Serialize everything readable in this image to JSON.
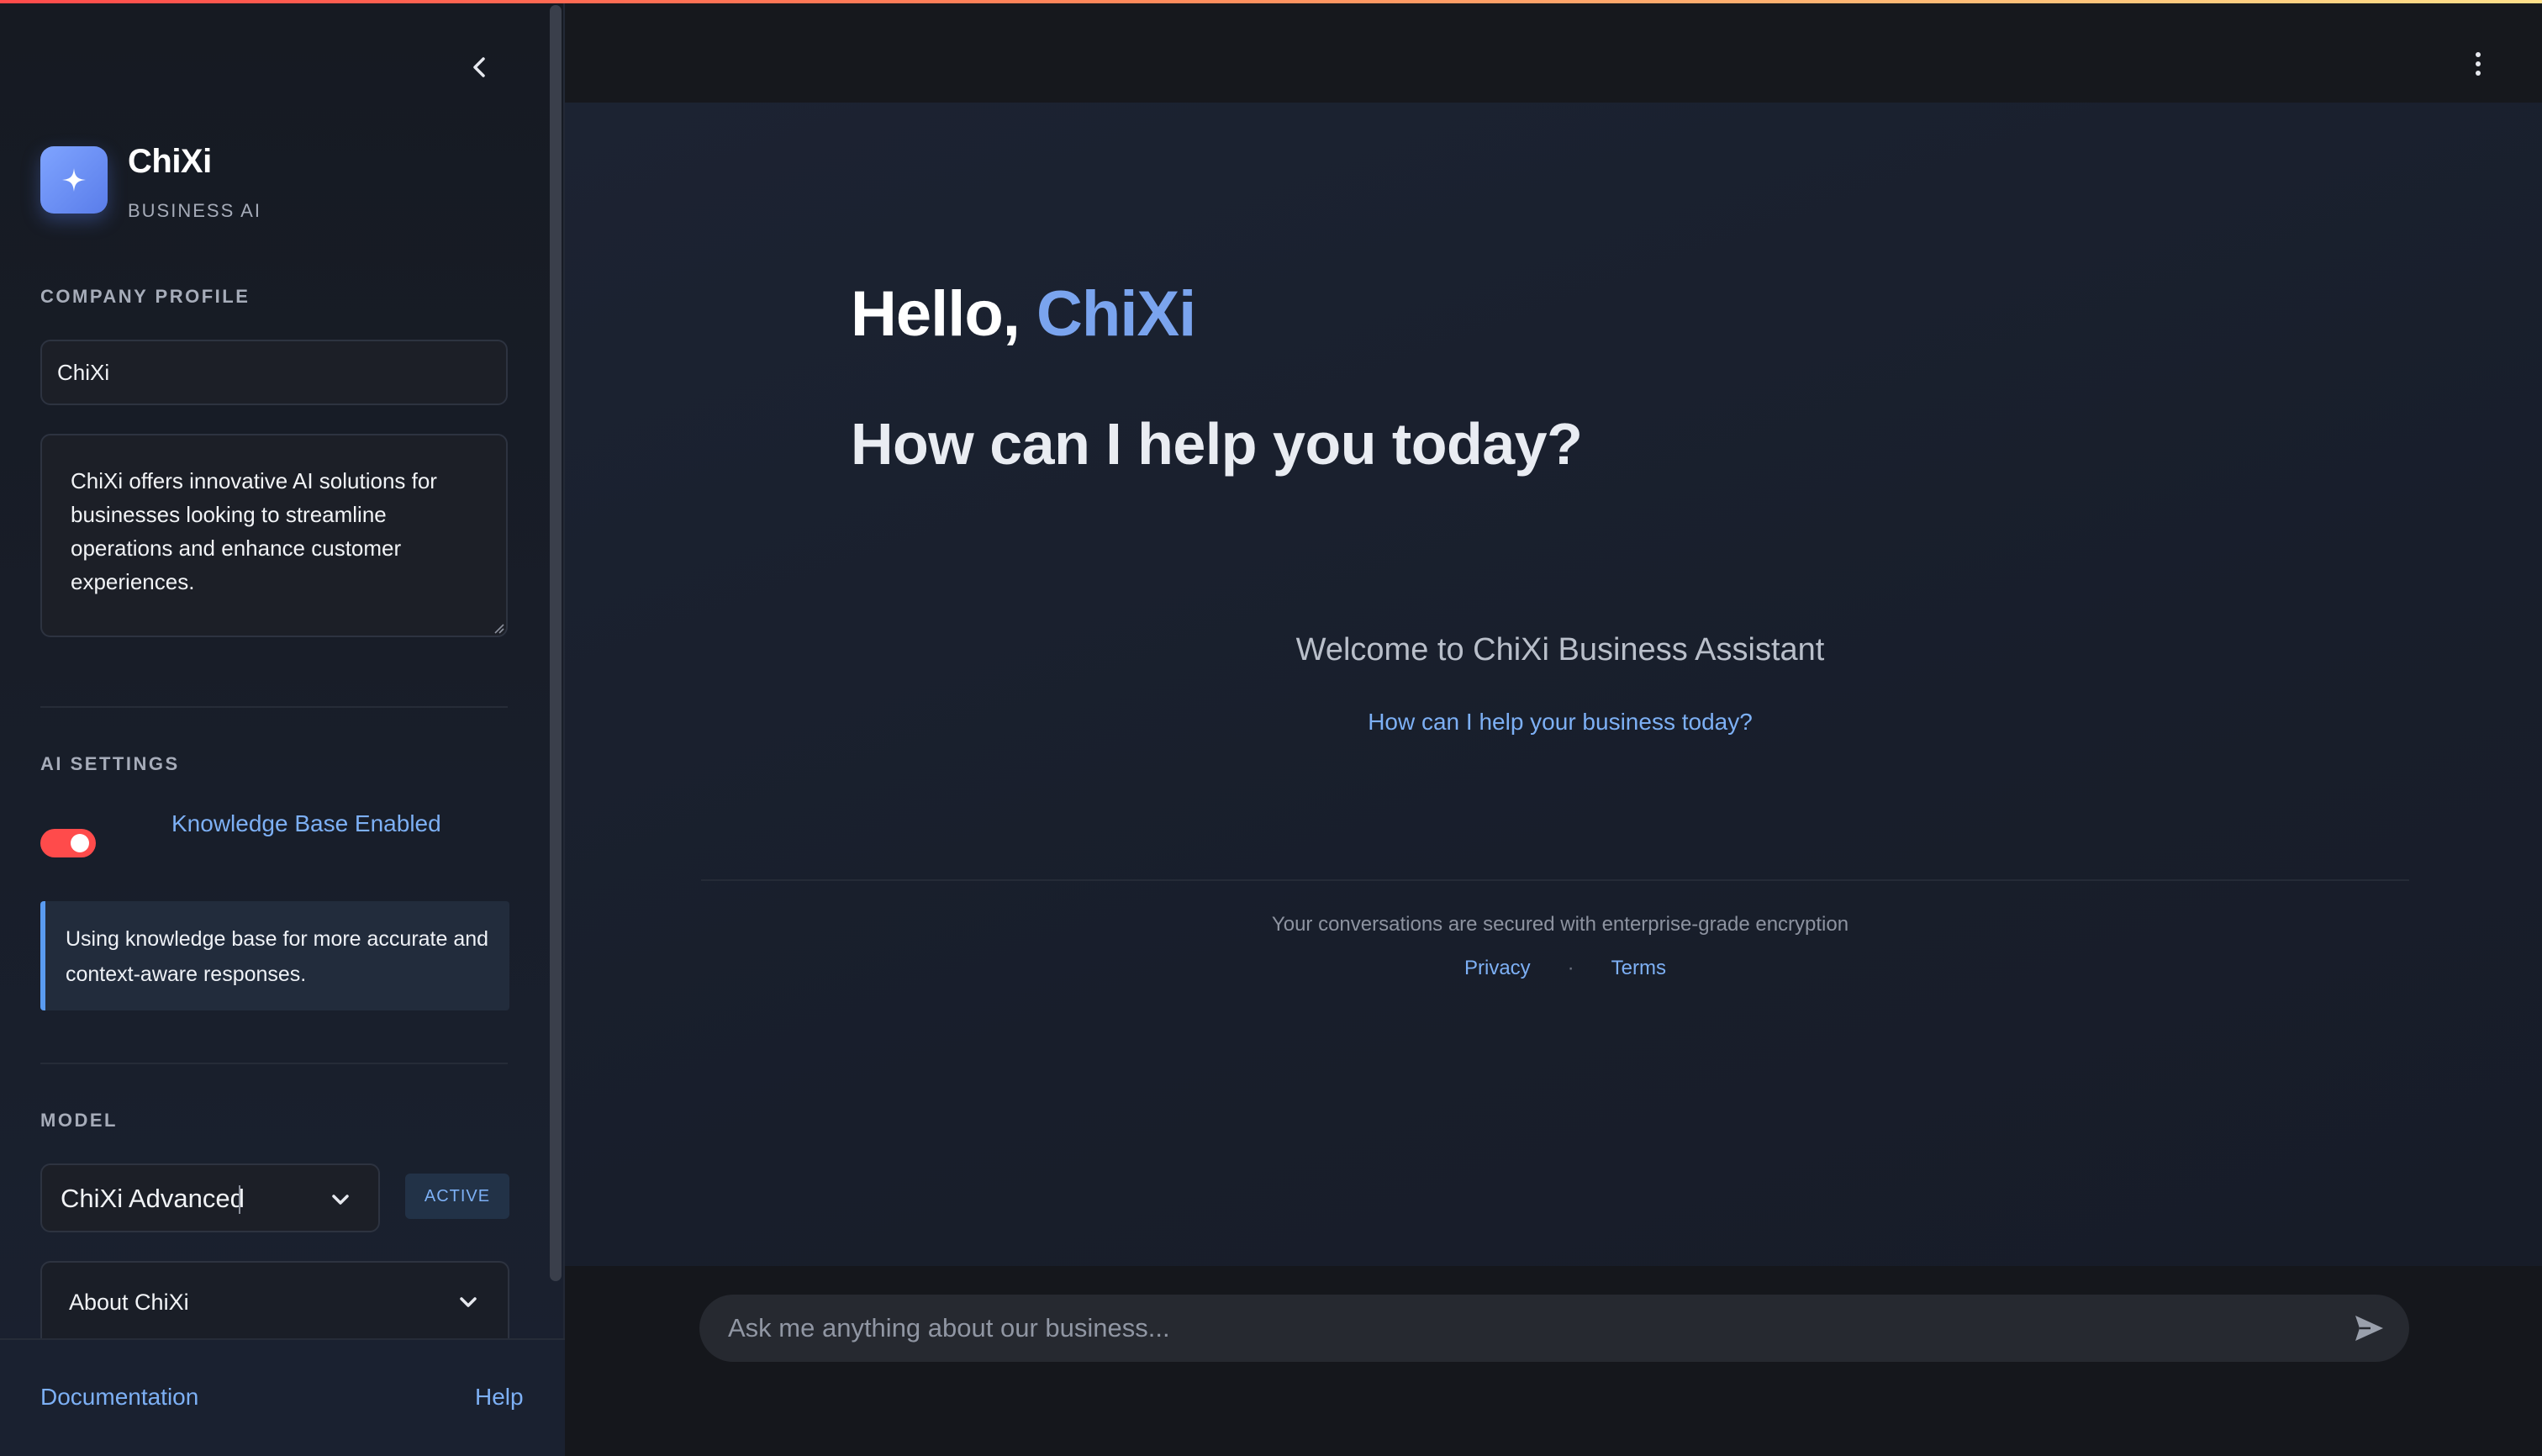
{
  "sidebar": {
    "brand": {
      "name": "ChiXi",
      "subtitle": "BUSINESS AI",
      "logo_icon": "sparkle-icon"
    },
    "company_profile": {
      "label": "COMPANY PROFILE",
      "name_value": "ChiXi",
      "description_value": "ChiXi offers innovative AI solutions for businesses looking to streamline operations and enhance customer experiences."
    },
    "ai_settings": {
      "label": "AI SETTINGS",
      "toggle_label": "Knowledge Base Enabled",
      "toggle_on": true,
      "info_text": "Using knowledge base for more accurate and context-aware responses."
    },
    "model": {
      "label": "MODEL",
      "selected": "ChiXi Advanced",
      "badge": "ACTIVE"
    },
    "about": {
      "label": "About ChiXi"
    },
    "footer": {
      "documentation": "Documentation",
      "help": "Help"
    }
  },
  "main": {
    "greeting_prefix": "Hello, ",
    "greeting_name": "ChiXi",
    "subheading": "How can I help you today?",
    "welcome_title": "Welcome to ChiXi Business Assistant",
    "welcome_prompt": "How can I help your business today?",
    "secured_note": "Your conversations are secured with enterprise-grade encryption",
    "privacy": "Privacy",
    "separator": "·",
    "terms": "Terms"
  },
  "chat": {
    "placeholder": "Ask me anything about our business...",
    "send_icon": "send-icon"
  },
  "colors": {
    "accent": "#7aa4ee",
    "link": "#7db0f5",
    "toggle_on": "#ff4b4b",
    "background": "#0e1117"
  }
}
